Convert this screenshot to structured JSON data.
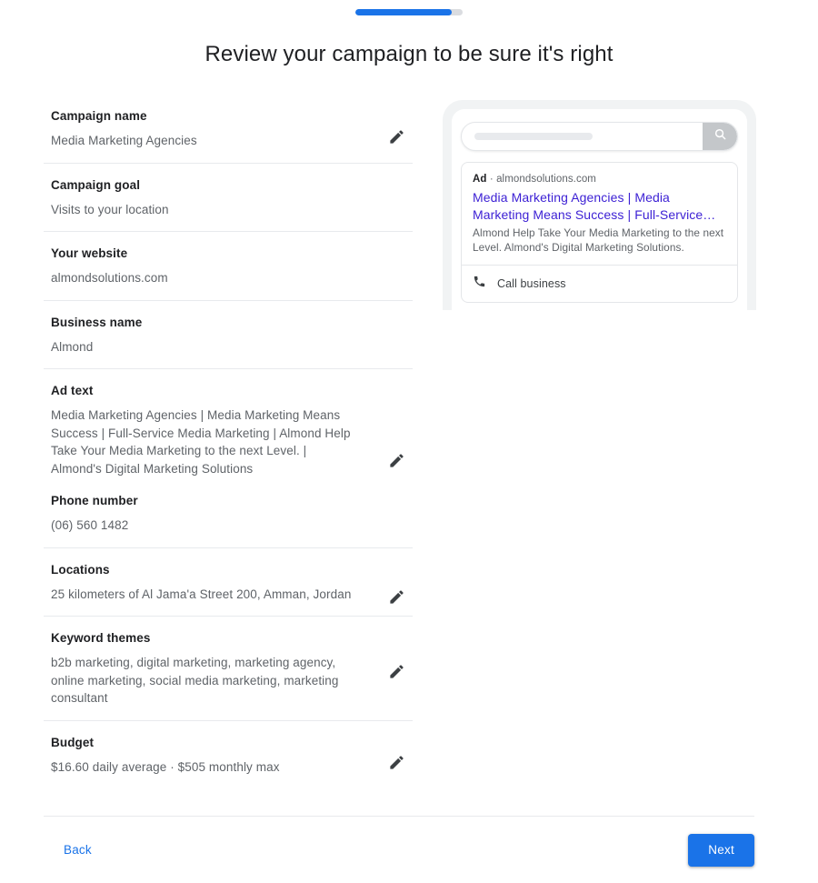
{
  "progress": {
    "percent": 90,
    "fill_color": "#1a73e8",
    "track_color": "#dadce0"
  },
  "page_title": "Review your campaign to be sure it's right",
  "review": {
    "edit_icon_name": "pencil-edit-icon",
    "sections": [
      {
        "label": "Campaign name",
        "value": "Media Marketing Agencies",
        "editable": true
      },
      {
        "label": "Campaign goal",
        "value": "Visits to your location",
        "editable": false
      },
      {
        "label": "Your website",
        "value": "almondsolutions.com",
        "editable": false
      },
      {
        "label": "Business name",
        "value": "Almond",
        "editable": false
      },
      {
        "label": "Ad text",
        "value": "Media Marketing Agencies | Media Marketing Means Success | Full-Service Media Marketing | Almond Help Take Your Media Marketing to the next Level. | Almond's Digital Marketing Solutions",
        "editable": true,
        "sub_label": "Phone number",
        "sub_value": "(06) 560 1482"
      },
      {
        "label": "Locations",
        "value": "25 kilometers of Al Jama'a Street 200, Amman, Jordan",
        "editable": true
      },
      {
        "label": "Keyword themes",
        "value": "b2b marketing, digital marketing, marketing agency, online marketing, social media marketing, marketing consultant",
        "editable": true
      },
      {
        "label": "Budget",
        "value": "$16.60 daily average · $505 monthly max",
        "editable": true
      }
    ]
  },
  "preview": {
    "search": {
      "icon_name": "search-icon",
      "placeholder": ""
    },
    "ad": {
      "badge": "Ad",
      "separator": "·",
      "display_url": "almondsolutions.com",
      "headline": "Media Marketing Agencies | Media Marketing Means Success | Full-Service…",
      "description": "Almond Help Take Your Media Marketing to the next Level. Almond's Digital Marketing Solutions.",
      "headline_color": "#3b1fd4",
      "action_label": "Call business",
      "action_icon_name": "phone-icon"
    }
  },
  "footer": {
    "back_label": "Back",
    "next_label": "Next",
    "accent_color": "#1a73e8"
  }
}
